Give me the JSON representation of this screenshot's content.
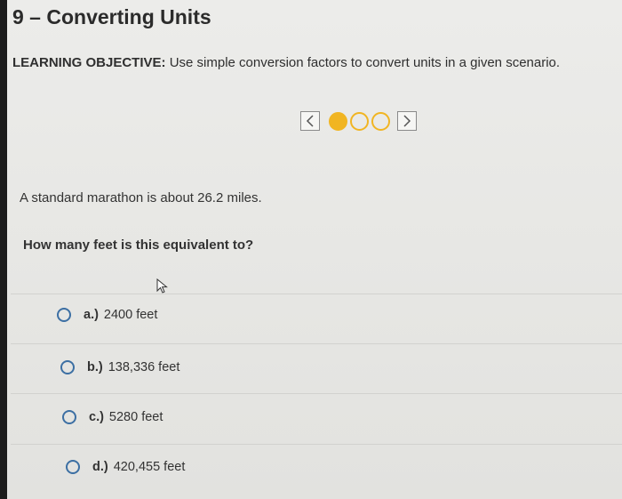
{
  "title": "9 – Converting Units",
  "objective": {
    "label": "LEARNING OBJECTIVE:",
    "text": "Use simple conversion factors to convert units in a given scenario."
  },
  "pager": {
    "prev_glyph": "<",
    "next_glyph": ">",
    "current": 1,
    "total": 3
  },
  "question": {
    "prompt": "A standard marathon is about 26.2 miles.",
    "text": "How many feet is this equivalent to?"
  },
  "options": [
    {
      "letter": "a.)",
      "text": "2400 feet"
    },
    {
      "letter": "b.)",
      "text": "138,336 feet"
    },
    {
      "letter": "c.)",
      "text": "5280 feet"
    },
    {
      "letter": "d.)",
      "text": "420,455 feet"
    }
  ],
  "colors": {
    "accent_dot": "#f1b522",
    "radio_border": "#3c6fa3"
  }
}
